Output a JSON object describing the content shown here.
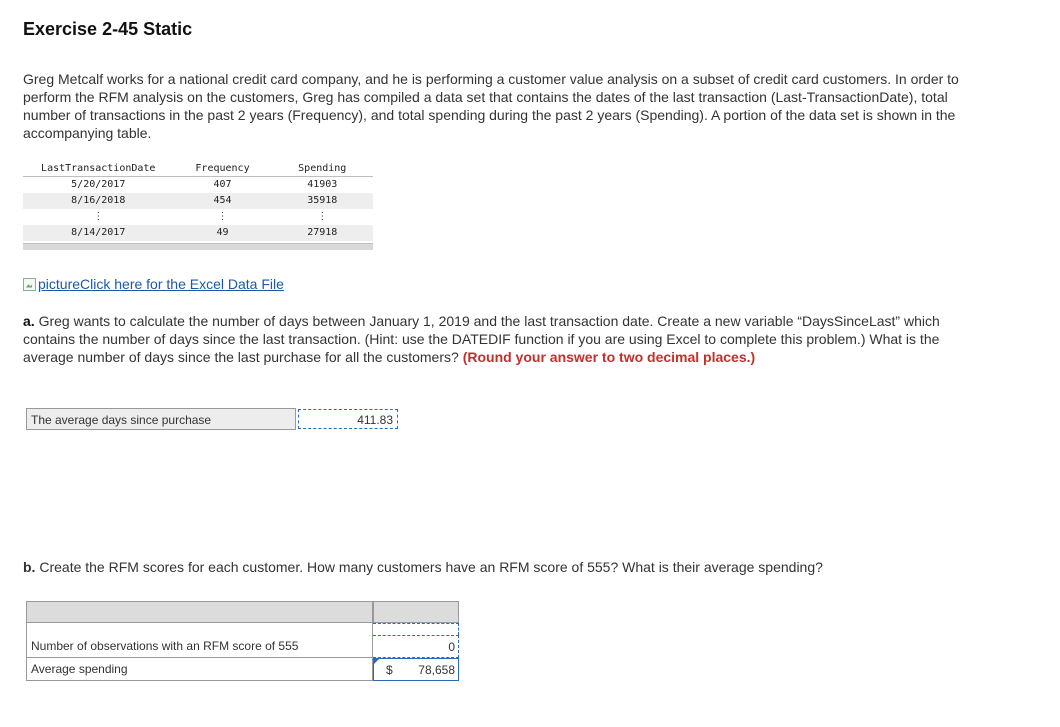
{
  "page": {
    "title": "Exercise 2-45 Static",
    "intro": "Greg Metcalf works for a national credit card company, and he is performing a customer value analysis on a subset of credit card customers. In order to perform the RFM analysis on the customers, Greg has compiled a data set that contains the dates of the last transaction (Last-TransactionDate), total number of transactions in the past 2 years (Frequency), and total spending during the past 2 years (Spending). A portion of the data set is shown in the accompanying table."
  },
  "data_table": {
    "headers": [
      "LastTransactionDate",
      "Frequency",
      "Spending"
    ],
    "rows": [
      [
        "5/20/2017",
        "407",
        "41903"
      ],
      [
        "8/16/2018",
        "454",
        "35918"
      ],
      [
        "⋮",
        "⋮",
        "⋮"
      ],
      [
        "8/14/2017",
        "49",
        "27918"
      ]
    ]
  },
  "excel_link": {
    "alt": "picture",
    "label": "Click here for the Excel Data File"
  },
  "question_a": {
    "label": "a.",
    "text": "Greg wants to calculate the number of days between January 1, 2019 and the last transaction date. Create a new variable “DaysSinceLast” which contains the number of days since the last transaction. (Hint: use the DATEDIF function if you are using Excel to complete this problem.) What is the average number of days since the last purchase for all the customers?",
    "instruction": "(Round your answer to two decimal places.)"
  },
  "answer_a": {
    "label": "The average days since purchase",
    "value": "411.83"
  },
  "question_b": {
    "label": "b.",
    "text": "Create the RFM scores for each customer. How many customers have an RFM score of 555? What is their average spending?"
  },
  "answer_b": {
    "rows": [
      {
        "label": "Number of observations with an RFM score of 555",
        "currency": "",
        "value": "0"
      },
      {
        "label": "Average spending",
        "currency": "$",
        "value": "78,658"
      }
    ]
  }
}
